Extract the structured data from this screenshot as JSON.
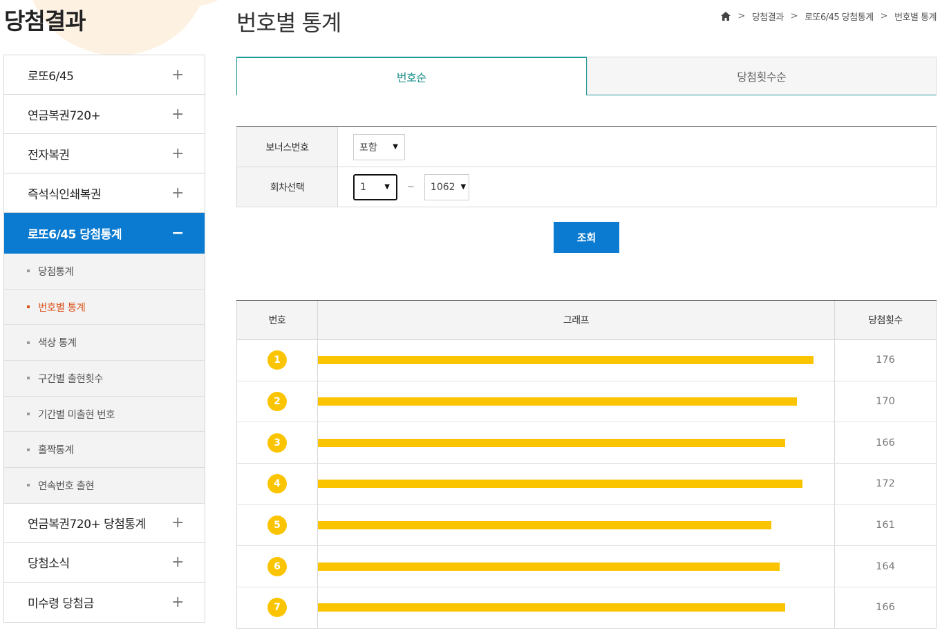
{
  "section_title": "당첨결과",
  "page_title": "번호별 통계",
  "breadcrumb": [
    "당첨결과",
    "로또6/45 당첨통계",
    "번호별 통계"
  ],
  "sidebar": {
    "items_top": [
      {
        "label": "로또6/45"
      },
      {
        "label": "연금복권720+"
      },
      {
        "label": "전자복권"
      },
      {
        "label": "즉석식인쇄복권"
      }
    ],
    "active": {
      "label": "로또6/45 당첨통계"
    },
    "sub_items": [
      {
        "label": "당첨통계"
      },
      {
        "label": "번호별 통계"
      },
      {
        "label": "색상 통계"
      },
      {
        "label": "구간별 출현횟수"
      },
      {
        "label": "기간별 미출현 번호"
      },
      {
        "label": "홀짝통계"
      },
      {
        "label": "연속번호 출현"
      }
    ],
    "items_bottom": [
      {
        "label": "연금복권720+ 당첨통계"
      },
      {
        "label": "당첨소식"
      },
      {
        "label": "미수령 당첨금"
      }
    ]
  },
  "tabs": [
    {
      "label": "번호순"
    },
    {
      "label": "당첨횟수순"
    }
  ],
  "filter": {
    "bonus_label": "보너스번호",
    "bonus_value": "포함",
    "round_label": "회차선택",
    "round_from": "1",
    "round_sep": "~",
    "round_to": "1062"
  },
  "search_button": "조회",
  "stats_header": {
    "number": "번호",
    "graph": "그래프",
    "count": "당첨횟수"
  },
  "chart_data": {
    "type": "bar",
    "categories": [
      "1",
      "2",
      "3",
      "4",
      "5",
      "6",
      "7"
    ],
    "values": [
      176,
      170,
      166,
      172,
      161,
      164,
      166
    ],
    "xlabel": "번호",
    "ylabel": "당첨횟수",
    "bar_color": "#fbc400"
  },
  "colors": {
    "accent_blue": "#0a7bd0",
    "tab_teal": "#1f9a97",
    "current_sub": "#d9531e",
    "ball_yellow": "#fbc400"
  }
}
